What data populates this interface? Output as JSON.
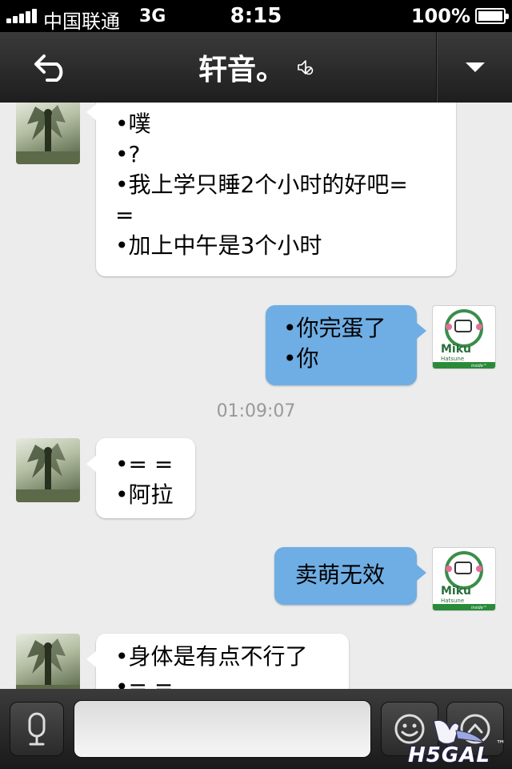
{
  "status_bar": {
    "carrier": "中国联通",
    "network": "3G",
    "time": "8:15",
    "battery": "100%"
  },
  "nav": {
    "title": "轩音。",
    "back_icon": "back-arrow-icon",
    "mute_icon": "mute-icon",
    "menu_icon": "dropdown-triangle-icon"
  },
  "messages": [
    {
      "side": "left",
      "lines": [
        "•噗",
        "•?",
        "•我上学只睡2个小时的好吧=",
        "=",
        "•加上中午是3个小时"
      ]
    },
    {
      "side": "right",
      "lines": [
        "•你完蛋了",
        "•你"
      ]
    },
    {
      "timestamp": "01:09:07"
    },
    {
      "side": "left",
      "lines": [
        "•= =",
        "•阿拉"
      ]
    },
    {
      "side": "right",
      "lines": [
        "卖萌无效"
      ]
    },
    {
      "side": "left",
      "lines": [
        "•身体是有点不行了",
        "•= ="
      ]
    }
  ],
  "self_avatar": {
    "line1": "Miku",
    "line2": "Hatsune",
    "line3": "inside™"
  },
  "input_bar": {
    "text_value": "",
    "voice_icon": "microphone-icon",
    "emoji_icon": "smiley-icon",
    "more_icon": "chevron-up-icon"
  },
  "watermark": {
    "text": "H5GAL",
    "tm": "™"
  },
  "colors": {
    "accent_bubble": "#6faee4",
    "background": "#ececec"
  }
}
